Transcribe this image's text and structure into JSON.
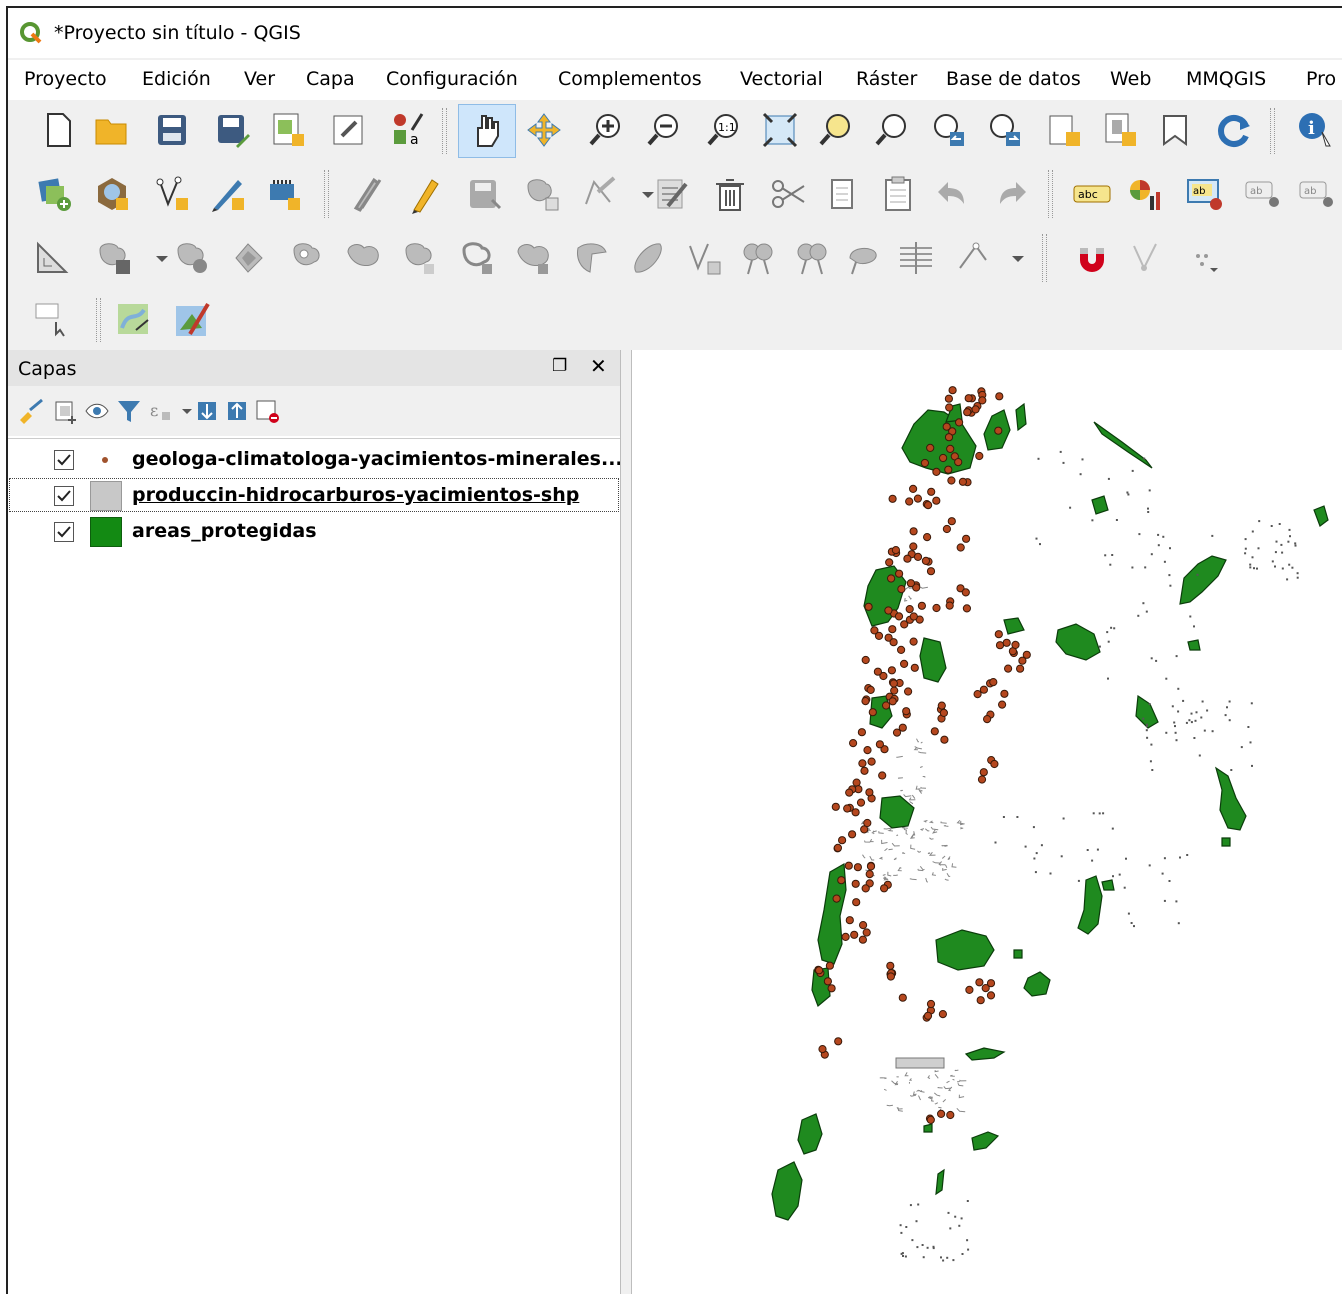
{
  "window": {
    "title": "*Proyecto sin título - QGIS"
  },
  "menu": [
    "Proyecto",
    "Edición",
    "Ver",
    "Capa",
    "Configuración",
    "Complementos",
    "Vectorial",
    "Ráster",
    "Base de datos",
    "Web",
    "MMQGIS",
    "Pro"
  ],
  "toolbar": {
    "label_size_value": "12"
  },
  "layers_panel": {
    "title": "Capas",
    "layers": [
      {
        "name": "geologa-climatologa-yacimientos-minerales...",
        "visible": true,
        "symbol": "point",
        "color": "#a0522d"
      },
      {
        "name": "produccin-hidrocarburos-yacimientos-shp",
        "visible": true,
        "symbol": "fill",
        "color": "#c8c8c8"
      },
      {
        "name": "areas_protegidas",
        "visible": true,
        "symbol": "fill",
        "color": "#138a13"
      }
    ]
  },
  "map": {
    "fill_green": "#1f8a1f",
    "point_color": "#b5471e",
    "hydro_color": "#9a9a9a"
  }
}
